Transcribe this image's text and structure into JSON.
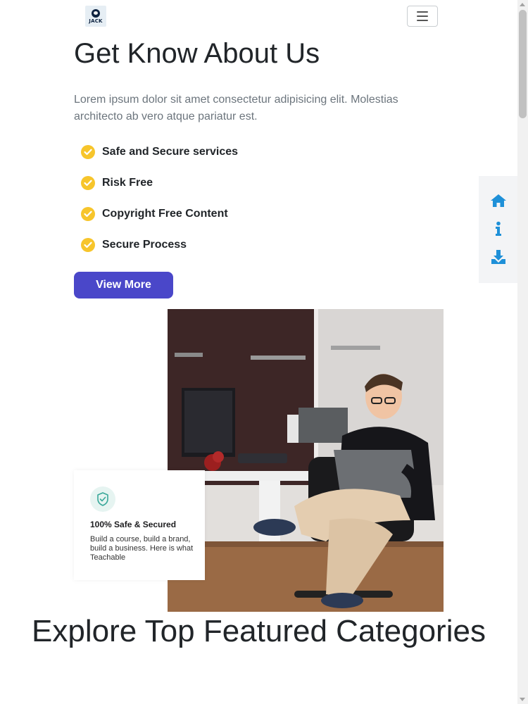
{
  "brand": {
    "logo_text": "JACK",
    "logo_icon": "jack-logo"
  },
  "navbar": {
    "toggler_icon": "hamburger-menu-icon"
  },
  "about": {
    "title": "Get Know About Us",
    "description": "Lorem ipsum dolor sit amet consectetur adipisicing elit. Molestias architecto ab vero atque pariatur est.",
    "features": [
      {
        "label": "Safe and Secure services",
        "icon": "check-circle-icon"
      },
      {
        "label": "Risk Free",
        "icon": "check-circle-icon"
      },
      {
        "label": "Copyright Free Content",
        "icon": "check-circle-icon"
      },
      {
        "label": "Secure Process",
        "icon": "check-circle-icon"
      }
    ],
    "button_label": "View More"
  },
  "safe_card": {
    "icon": "shield-check-icon",
    "title": "100% Safe & Secured",
    "text": "Build a course, build a brand, build a business. Here is what Teachable"
  },
  "side_panel": {
    "items": [
      {
        "icon": "home-icon"
      },
      {
        "icon": "info-icon"
      },
      {
        "icon": "download-icon"
      }
    ]
  },
  "explore": {
    "title": "Explore Top Featured Categories"
  },
  "colors": {
    "primary_button": "#4a47c9",
    "check": "#f7c52b",
    "side_icons": "#1e90d8",
    "text": "#212529",
    "muted": "#6c757d"
  }
}
